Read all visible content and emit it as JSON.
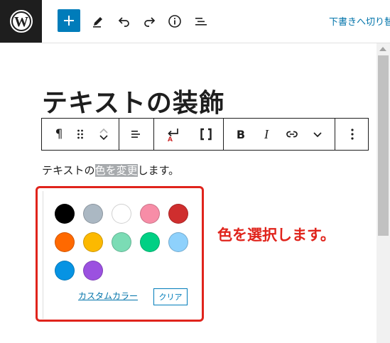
{
  "topbar": {
    "save_draft_label": "下書きへ切り替",
    "icons": [
      "wordpress-logo",
      "plus-icon",
      "pencil-icon",
      "undo-icon",
      "redo-icon",
      "info-icon",
      "list-view-icon"
    ]
  },
  "editor": {
    "title": "テキストの装飾",
    "paragraph": {
      "before": "テキストの",
      "highlight": "色を変更",
      "after": "します。"
    }
  },
  "block_toolbar": {
    "icons": [
      "paragraph-icon",
      "drag-handle-icon",
      "move-up-down-icon",
      "align-icon",
      "text-color-icon",
      "shortcode-bracket-icon",
      "bold-icon",
      "italic-icon",
      "link-icon",
      "more-chevron-icon",
      "options-icon"
    ],
    "bold_label": "B",
    "italic_label": "I",
    "paragraph_label": "¶"
  },
  "palette": {
    "colors": [
      "#000000",
      "#abb8c3",
      "#ffffff",
      "#f78da7",
      "#cf2e2e",
      "#ff6900",
      "#fcb900",
      "#7bdcb5",
      "#00d084",
      "#8ed1fc",
      "#0693e3",
      "#9b51e0"
    ],
    "custom_color_label": "カスタムカラー",
    "clear_label": "クリア"
  },
  "annotation": "色を選択します。"
}
